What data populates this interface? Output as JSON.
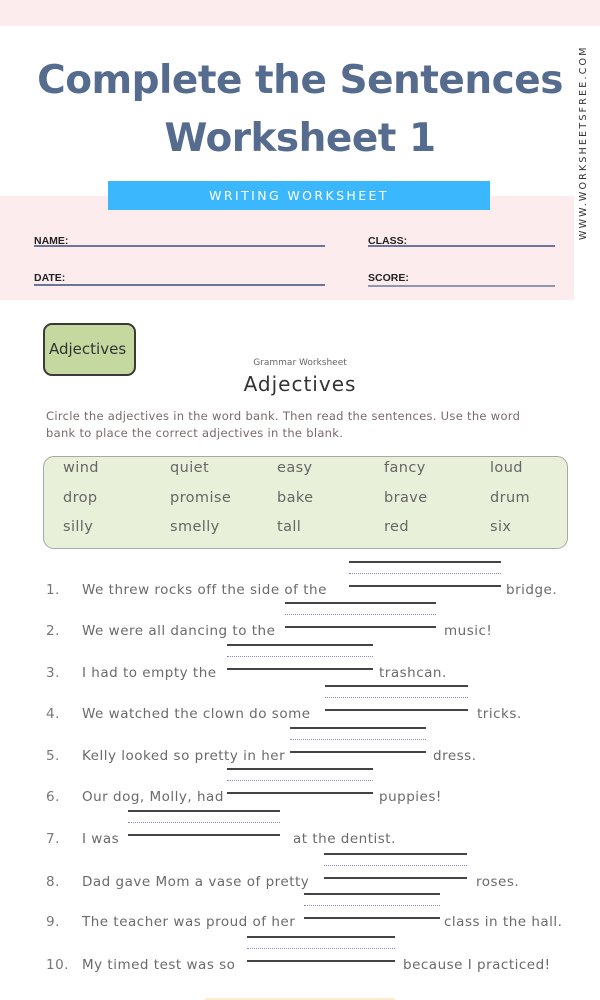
{
  "header": {
    "title_line1": "Complete the Sentences",
    "title_line2": "Worksheet 1",
    "banner": "WRITING WORKSHEET",
    "site_url": "WWW.WORKSHEETSFREE.COM"
  },
  "fields": {
    "name": "NAME:",
    "date": "DATE:",
    "class": "CLASS:",
    "score": "SCORE:"
  },
  "worksheet": {
    "tag": "Adjectives",
    "subtitle": "Grammar Worksheet",
    "heading": "Adjectives",
    "instructions": "Circle the adjectives in the word bank.  Then read the sentences.  Use the word bank to place the correct adjectives in the blank.",
    "word_bank": [
      [
        "wind",
        "quiet",
        "easy",
        "fancy",
        "loud"
      ],
      [
        "drop",
        "promise",
        "bake",
        "brave",
        "drum"
      ],
      [
        "silly",
        "smelly",
        "tall",
        "red",
        "six"
      ]
    ],
    "questions": [
      {
        "num": "1.",
        "before": "We threw rocks off the side of the",
        "after": "bridge."
      },
      {
        "num": "2.",
        "before": "We were all dancing to the",
        "after": "music!"
      },
      {
        "num": "3.",
        "before": "I had to empty the",
        "after": "trashcan."
      },
      {
        "num": "4.",
        "before": "We watched the clown do some",
        "after": "tricks."
      },
      {
        "num": "5.",
        "before": "Kelly looked so pretty in her",
        "after": "dress."
      },
      {
        "num": "6.",
        "before": "Our dog, Molly, had",
        "after": "puppies!"
      },
      {
        "num": "7.",
        "before": "I was",
        "after": "at the dentist."
      },
      {
        "num": "8.",
        "before": "Dad gave Mom a vase of pretty",
        "after": "roses."
      },
      {
        "num": "9.",
        "before": "The teacher was proud of her",
        "after": "class in the hall."
      },
      {
        "num": "10.",
        "before": "My timed test was so",
        "after": "because I practiced!"
      }
    ]
  }
}
